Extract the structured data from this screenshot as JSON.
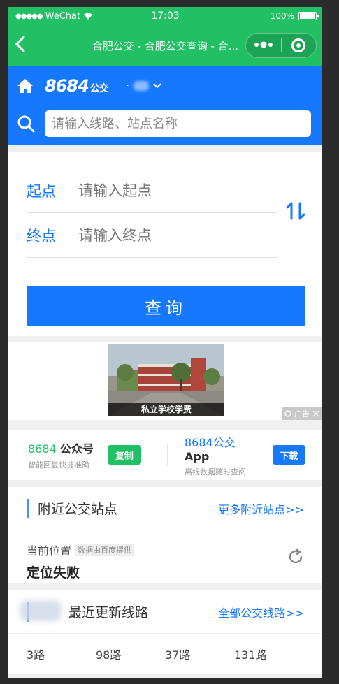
{
  "status_bar": {
    "carrier": "WeChat",
    "time": "17:03",
    "battery": "100%",
    "battery_level": 1.0
  },
  "nav": {
    "title": "合肥公交 - 合肥公交查询 - 合...",
    "more_label": "•●•"
  },
  "header": {
    "logo_text": "8684",
    "logo_suffix": "公交",
    "city": "·",
    "search_placeholder": "请输入线路、站点名称"
  },
  "route": {
    "start_label": "起点",
    "start_placeholder": "请输入起点",
    "end_label": "终点",
    "end_placeholder": "请输入终点",
    "query_label": "查询"
  },
  "ad": {
    "caption": "私立学校学费",
    "tag": "广告"
  },
  "promo": {
    "wechat": {
      "brand": "8684",
      "name": "公众号",
      "sub": "智能回复快捷准确",
      "button": "复制"
    },
    "app": {
      "brand": "8684公交",
      "name": "App",
      "sub": "离线数据随时查阅",
      "button": "下载"
    }
  },
  "nearby": {
    "title": "附近公交站点",
    "more": "更多附近站点>>",
    "current_label": "当前位置",
    "provider": "数据由百度提供",
    "status": "定位失败"
  },
  "recent": {
    "title": "最近更新线路",
    "more": "全部公交线路>>",
    "lines": [
      "3路",
      "98路",
      "37路",
      "131路"
    ]
  },
  "colors": {
    "wechat_green": "#22c064",
    "brand_blue": "#1677ff"
  }
}
